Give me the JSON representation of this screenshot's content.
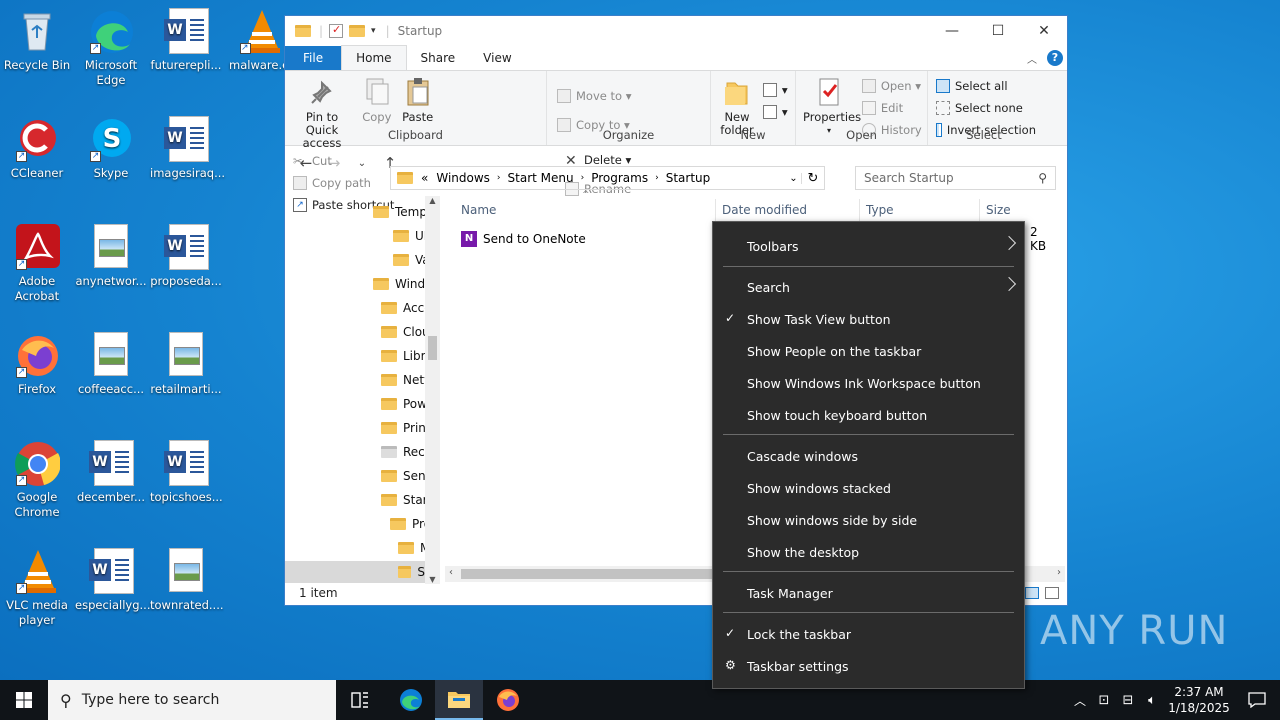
{
  "desktop": {
    "icons": [
      {
        "label": "Recycle Bin"
      },
      {
        "label": "Microsoft Edge"
      },
      {
        "label": "futurerepli..."
      },
      {
        "label": "malware.e"
      },
      {
        "label": "CCleaner"
      },
      {
        "label": "Skype"
      },
      {
        "label": "imagesiraq..."
      },
      {
        "label": "Adobe Acrobat"
      },
      {
        "label": "anynetwor..."
      },
      {
        "label": "proposeda..."
      },
      {
        "label": "Firefox"
      },
      {
        "label": "coffeeacc..."
      },
      {
        "label": "retailmarti..."
      },
      {
        "label": "Google Chrome"
      },
      {
        "label": "december..."
      },
      {
        "label": "topicshoes..."
      },
      {
        "label": "VLC media player"
      },
      {
        "label": "especiallyg..."
      },
      {
        "label": "townrated...."
      }
    ]
  },
  "explorer": {
    "title": "Startup",
    "tabs": [
      "File",
      "Home",
      "Share",
      "View"
    ],
    "ribbon": {
      "clipboard": {
        "label": "Clipboard",
        "pin": "Pin to Quick access",
        "copy": "Copy",
        "paste": "Paste",
        "cut": "Cut",
        "copy_path": "Copy path",
        "paste_shortcut": "Paste shortcut"
      },
      "organize": {
        "label": "Organize",
        "move_to": "Move to",
        "copy_to": "Copy to",
        "delete": "Delete",
        "rename": "Rename"
      },
      "new": {
        "label": "New",
        "new_folder": "New folder"
      },
      "open": {
        "label": "Open",
        "properties": "Properties",
        "open": "Open",
        "edit": "Edit",
        "history": "History"
      },
      "select": {
        "label": "Select",
        "select_all": "Select all",
        "select_none": "Select none",
        "invert": "Invert selection"
      }
    },
    "address": {
      "prefix": "«",
      "crumbs": [
        "Windows",
        "Start Menu",
        "Programs",
        "Startup"
      ],
      "search_placeholder": "Search Startup"
    },
    "nav": [
      "Temp",
      "UProc",
      "Vault",
      "Windo",
      "Acce",
      "Clou",
      "Libra",
      "Netw",
      "Pow",
      "Print",
      "Rece",
      "Send",
      "Start",
      "Pro",
      "M",
      "S"
    ],
    "columns": {
      "name": "Name",
      "date": "Date modified",
      "type": "Type",
      "size": "Size"
    },
    "files": [
      {
        "name": "Send to OneNote",
        "size": "2 KB"
      }
    ],
    "status": "1 item"
  },
  "context_menu": {
    "items": [
      {
        "label": "Toolbars",
        "submenu": true
      },
      {
        "label": "Search",
        "submenu": true
      },
      {
        "label": "Show Task View button",
        "checked": true
      },
      {
        "label": "Show People on the taskbar"
      },
      {
        "label": "Show Windows Ink Workspace button"
      },
      {
        "label": "Show touch keyboard button"
      },
      {
        "label": "Cascade windows"
      },
      {
        "label": "Show windows stacked"
      },
      {
        "label": "Show windows side by side"
      },
      {
        "label": "Show the desktop"
      },
      {
        "label": "Task Manager"
      },
      {
        "label": "Lock the taskbar",
        "checked": true
      },
      {
        "label": "Taskbar settings",
        "icon": "gear-icon"
      }
    ]
  },
  "taskbar": {
    "search_placeholder": "Type here to search",
    "time": "2:37 AM",
    "date": "1/18/2025"
  },
  "watermark": "ANY RUN"
}
